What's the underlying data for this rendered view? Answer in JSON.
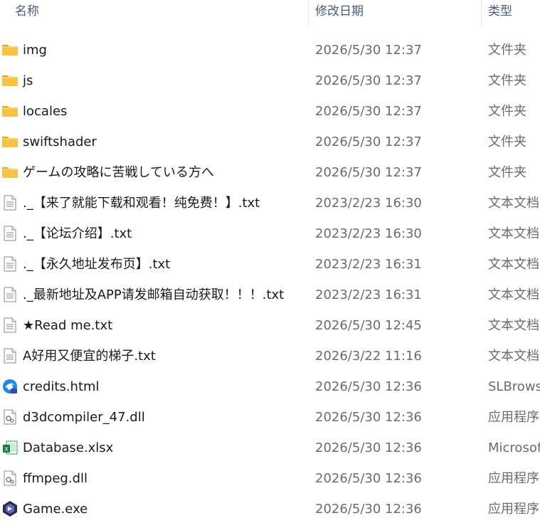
{
  "columns": {
    "name": "名称",
    "date": "修改日期",
    "type": "类型"
  },
  "files": [
    {
      "name": "img",
      "date": "2026/5/30 12:37",
      "type": "文件夹",
      "icon": "folder-icon"
    },
    {
      "name": "js",
      "date": "2026/5/30 12:37",
      "type": "文件夹",
      "icon": "folder-icon"
    },
    {
      "name": "locales",
      "date": "2026/5/30 12:37",
      "type": "文件夹",
      "icon": "folder-icon"
    },
    {
      "name": "swiftshader",
      "date": "2026/5/30 12:37",
      "type": "文件夹",
      "icon": "folder-icon"
    },
    {
      "name": "ゲームの攻略に苦戦している方へ",
      "date": "2026/5/30 12:37",
      "type": "文件夹",
      "icon": "folder-icon"
    },
    {
      "name": "._【来了就能下载和观看！纯免费！】.txt",
      "date": "2023/2/23 16:30",
      "type": "文本文档",
      "icon": "text-file-icon"
    },
    {
      "name": "._【论坛介绍】.txt",
      "date": "2023/2/23 16:30",
      "type": "文本文档",
      "icon": "text-file-icon"
    },
    {
      "name": "._【永久地址发布页】.txt",
      "date": "2023/2/23 16:31",
      "type": "文本文档",
      "icon": "text-file-icon"
    },
    {
      "name": "._最新地址及APP请发邮箱自动获取！！！.txt",
      "date": "2023/2/23 16:31",
      "type": "文本文档",
      "icon": "text-file-icon"
    },
    {
      "name": "★Read me.txt",
      "date": "2026/5/30 12:45",
      "type": "文本文档",
      "icon": "text-file-icon"
    },
    {
      "name": "A好用又便宜的梯子.txt",
      "date": "2026/3/22 11:16",
      "type": "文本文档",
      "icon": "text-file-icon"
    },
    {
      "name": "credits.html",
      "date": "2026/5/30 12:36",
      "type": "SLBrowser",
      "icon": "browser-html-icon"
    },
    {
      "name": "d3dcompiler_47.dll",
      "date": "2026/5/30 12:36",
      "type": "应用程序扩展",
      "icon": "dll-file-icon"
    },
    {
      "name": "Database.xlsx",
      "date": "2026/5/30 12:36",
      "type": "Microsoft",
      "icon": "excel-file-icon"
    },
    {
      "name": "ffmpeg.dll",
      "date": "2026/5/30 12:36",
      "type": "应用程序扩展",
      "icon": "dll-file-icon"
    },
    {
      "name": "Game.exe",
      "date": "2026/5/30 12:36",
      "type": "应用程序",
      "icon": "game-exe-icon"
    }
  ],
  "colors": {
    "header_text": "#4a5b78",
    "date_text": "#6b6b6b",
    "folder": "#f6c344"
  }
}
